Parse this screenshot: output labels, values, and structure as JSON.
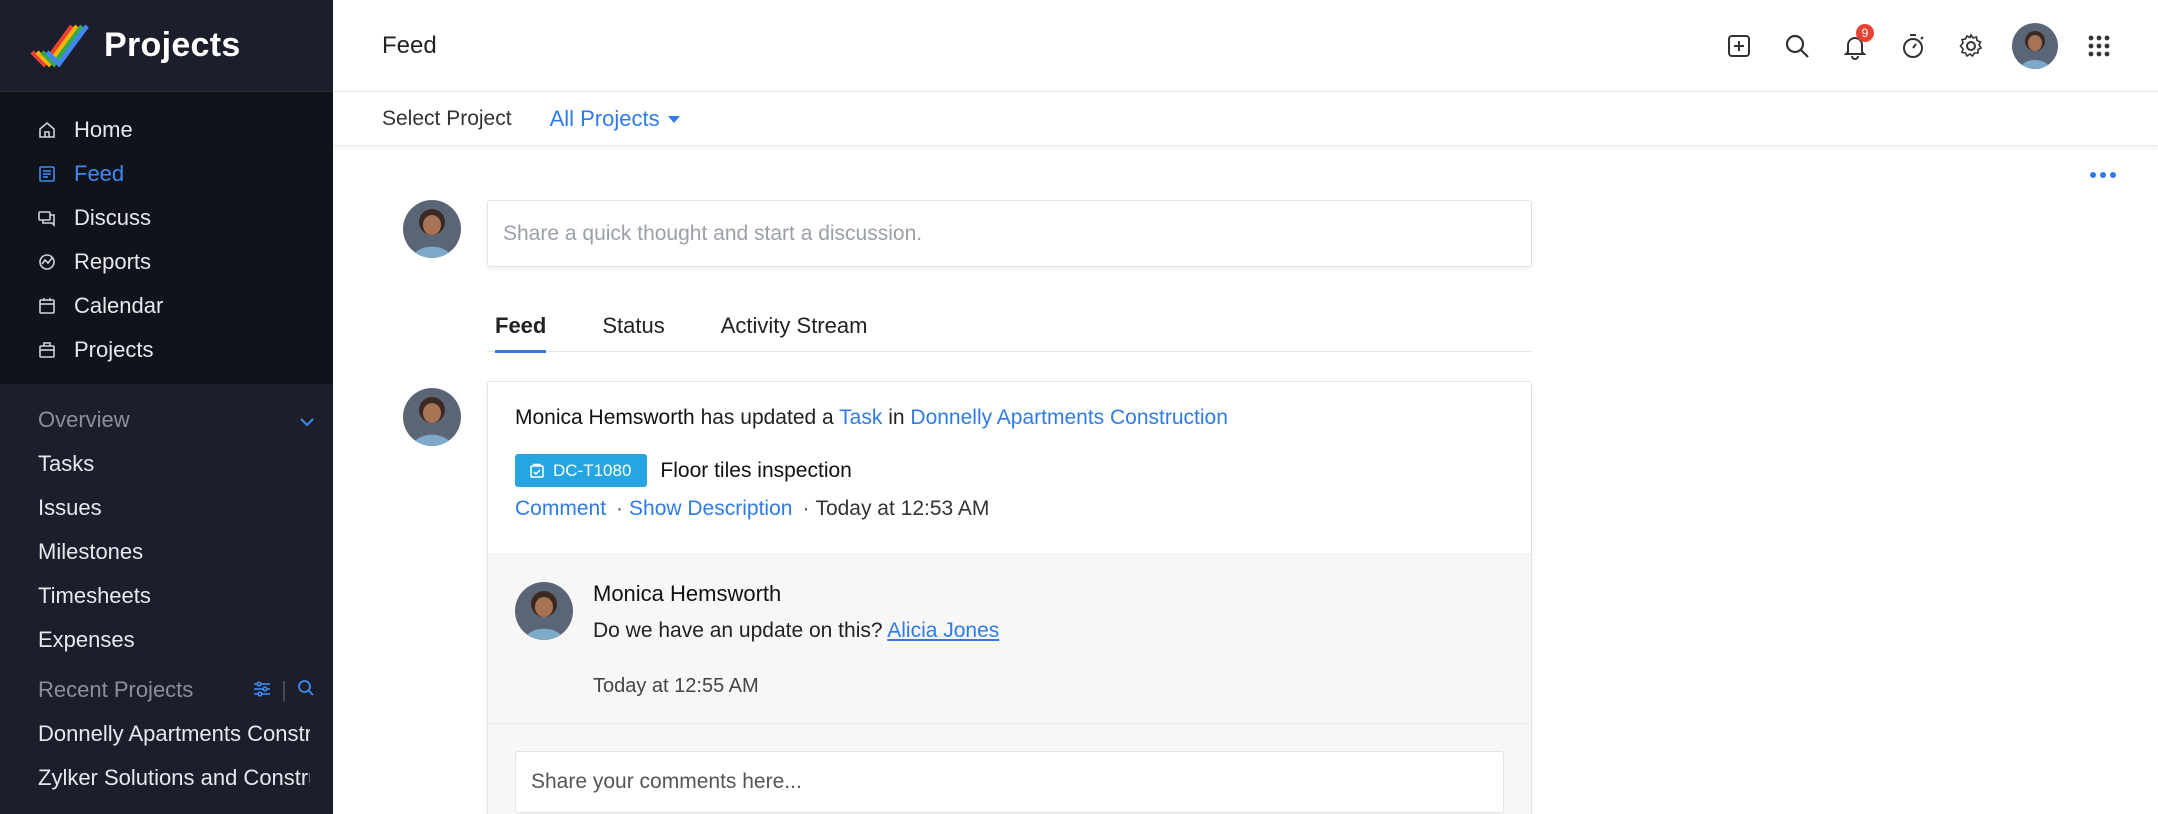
{
  "app": {
    "brand": "Projects"
  },
  "sidebar": {
    "nav": [
      {
        "label": "Home",
        "icon": "home-icon"
      },
      {
        "label": "Feed",
        "icon": "feed-icon",
        "active": true
      },
      {
        "label": "Discuss",
        "icon": "discuss-icon"
      },
      {
        "label": "Reports",
        "icon": "reports-icon"
      },
      {
        "label": "Calendar",
        "icon": "calendar-icon"
      },
      {
        "label": "Projects",
        "icon": "projects-icon"
      }
    ],
    "overview": {
      "heading": "Overview",
      "items": [
        "Tasks",
        "Issues",
        "Milestones",
        "Timesheets",
        "Expenses"
      ]
    },
    "recent": {
      "heading": "Recent Projects",
      "items": [
        "Donnelly Apartments Construction",
        "Zylker Solutions and Construction"
      ]
    }
  },
  "topbar": {
    "title": "Feed",
    "notification_count": "9",
    "icons": [
      "add-icon",
      "search-icon",
      "bell-icon",
      "timer-icon",
      "gear-icon",
      "avatar",
      "apps-grid-icon"
    ]
  },
  "subbar": {
    "label": "Select Project",
    "value": "All Projects"
  },
  "composer": {
    "placeholder": "Share a quick thought and start a discussion."
  },
  "tabs": [
    "Feed",
    "Status",
    "Activity Stream"
  ],
  "feed_item": {
    "user": "Monica Hemsworth",
    "action": "has updated a",
    "object": "Task",
    "in": "in",
    "project": "Donnelly Apartments Construction",
    "task_id": "DC-T1080",
    "task_title": "Floor tiles inspection",
    "comment_link": "Comment",
    "show_desc": "Show Description",
    "time": "Today at 12:53 AM",
    "comment": {
      "author": "Monica Hemsworth",
      "text": "Do we have an update on this?",
      "mention": "Alicia Jones",
      "time": "Today at 12:55 AM"
    },
    "comment_placeholder": "Share your comments here..."
  },
  "colors": {
    "accent": "#2f7be6",
    "sidebar": "#1c1f2b",
    "chip": "#26a6e0",
    "badge": "#e94235"
  }
}
